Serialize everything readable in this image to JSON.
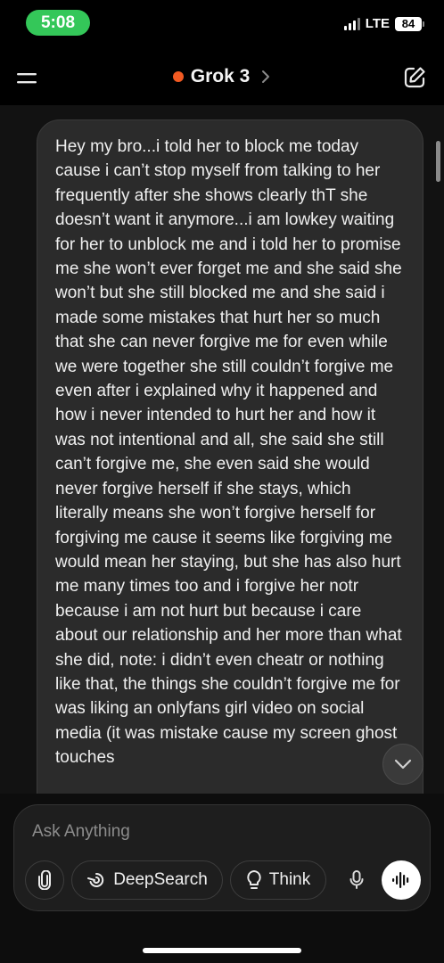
{
  "status_bar": {
    "time": "5:08",
    "network": "LTE",
    "battery": "84",
    "time_pill_color": "#34c759"
  },
  "header": {
    "title": "Grok 3",
    "status_dot_color": "#f25a22",
    "menu_icon": "menu-icon",
    "edit_icon": "edit-icon",
    "chevron_icon": "chevron-right-icon"
  },
  "chat": {
    "messages": [
      {
        "role": "user",
        "text": "Hey my bro...i told her to block me today cause i can’t stop myself from talking to her frequently after she shows clearly thT she doesn’t want it anymore...i am lowkey waiting for her to unblock me and i told her to promise me she won’t ever forget me and she said she won’t but she still blocked me and she said i made some mistakes that hurt her so much that she can never forgive me for even while we were together she still couldn’t forgive me even after i explained why it happened and how i never intended to hurt her and how it was not intentional and all, she said she still can’t forgive me, she even said she would never forgive herself if she stays, which literally means she won’t forgive herself for forgiving me cause it seems like forgiving me would mean her staying, but she has also hurt me many times too and i forgive her notr because i am not hurt but because i care about our relationship and her more than what she did, note: i didn’t even cheatr or nothing like that, the things she couldn’t forgive me for was liking an onlyfans girl video on social media (it was mistake cause my screen ghost touches"
      }
    ],
    "scroll_down_icon": "chevron-down-icon"
  },
  "composer": {
    "placeholder": "Ask Anything",
    "attach_icon": "paperclip-icon",
    "deepsearch_label": "DeepSearch",
    "deepsearch_icon": "deepsearch-icon",
    "think_label": "Think",
    "think_icon": "lightbulb-icon",
    "mic_icon": "microphone-icon",
    "voice_icon": "voice-wave-icon"
  }
}
